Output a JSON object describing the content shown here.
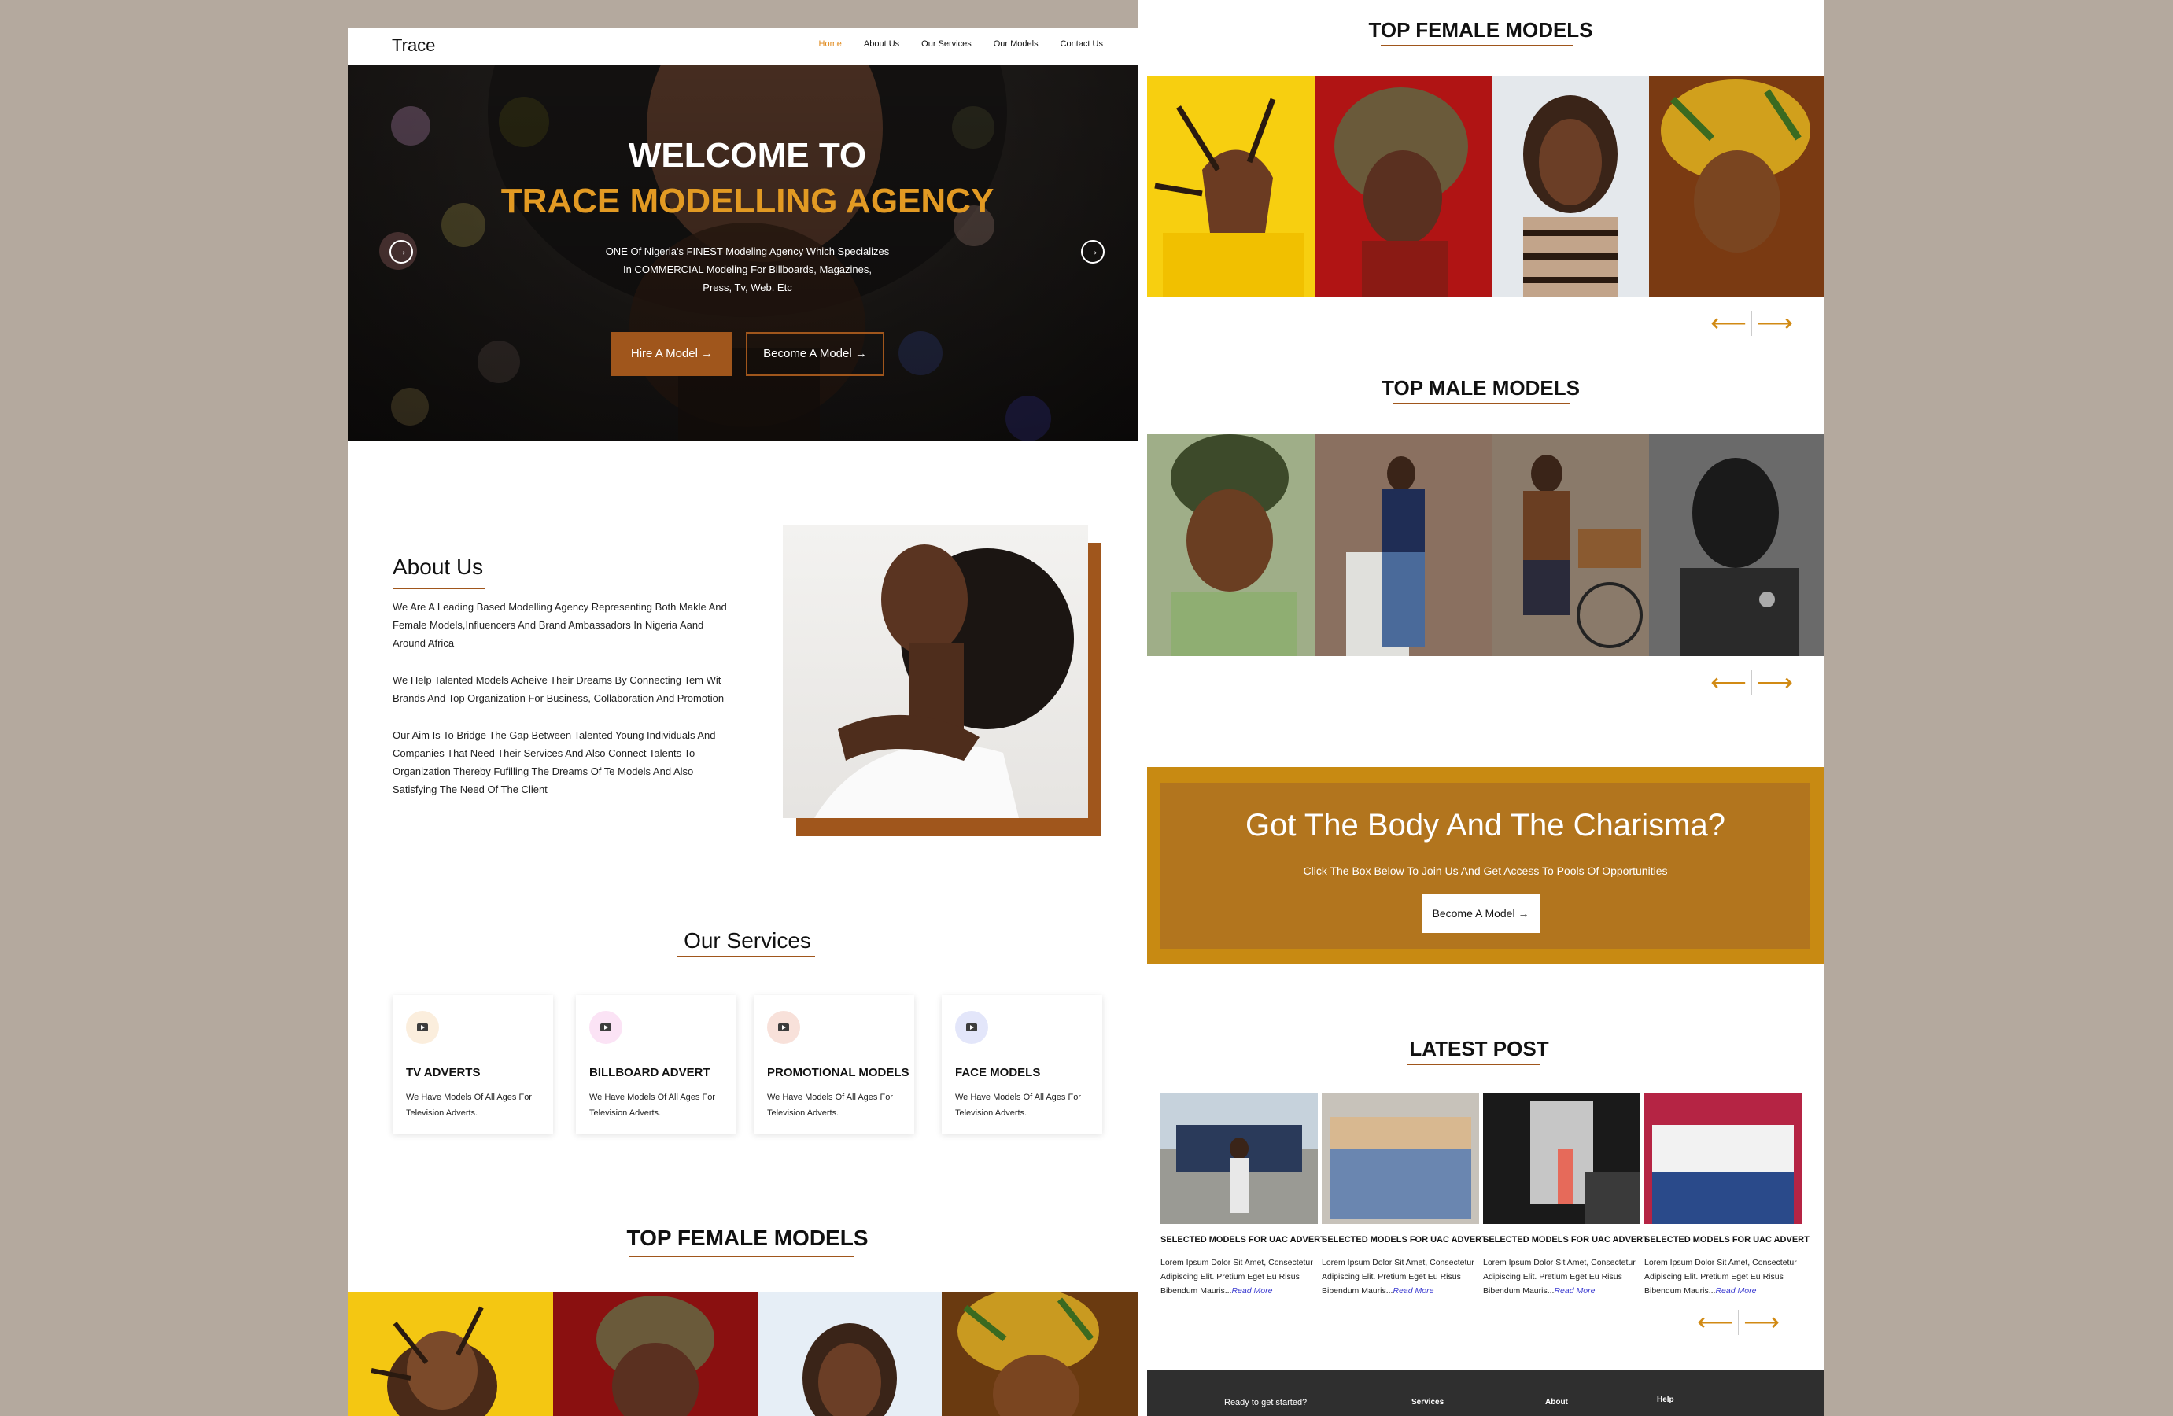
{
  "brand": "Trace",
  "nav": [
    {
      "label": "Home",
      "active": true
    },
    {
      "label": "About Us",
      "active": false
    },
    {
      "label": "Our Services",
      "active": false
    },
    {
      "label": "Our Models",
      "active": false
    },
    {
      "label": "Contact Us",
      "active": false
    }
  ],
  "hero": {
    "title_line1": "WELCOME TO",
    "title_line2": "TRACE MODELLING AGENCY",
    "subtitle_line1": "ONE Of Nigeria's FINEST Modeling Agency Which Specializes",
    "subtitle_line2": "In COMMERCIAL Modeling For Billboards, Magazines,",
    "subtitle_line3": "Press, Tv, Web. Etc",
    "btn_hire": "Hire A Model →",
    "btn_become": "Become A Model →",
    "prev_icon": "arrow-circle-left-icon",
    "next_icon": "arrow-circle-right-icon"
  },
  "about": {
    "title": "About Us",
    "p1": "We Are A Leading Based Modelling Agency Representing Both Makle And Female Models,Influencers And Brand Ambassadors In Nigeria Aand Around Africa",
    "p2": "We Help Talented Models Acheive Their Dreams By Connecting Tem Wit Brands And Top Organization For Business, Collaboration And Promotion",
    "p3": "Our Aim Is To Bridge The Gap Between Talented Young Individuals And Companies That Need Their Services And Also Connect Talents To Organization Thereby Fufilling The Dreams Of Te Models And Also Satisfying The Need Of The Client"
  },
  "services": {
    "title": "Our Services",
    "items": [
      {
        "title": "TV ADVERTS",
        "desc": "We Have Models Of All Ages For Television Adverts.",
        "icon": "youtube-icon",
        "icon_bg": "#fbeedd"
      },
      {
        "title": "BILLBOARD ADVERT",
        "desc": "We Have Models Of All Ages For Television Adverts.",
        "icon": "youtube-icon",
        "icon_bg": "#fbe3f5"
      },
      {
        "title": "PROMOTIONAL MODELS",
        "desc": "We Have Models Of All Ages For Television Adverts.",
        "icon": "youtube-icon",
        "icon_bg": "#f8e1da"
      },
      {
        "title": "FACE MODELS",
        "desc": "We Have Models Of All Ages For Television Adverts.",
        "icon": "youtube-icon",
        "icon_bg": "#e3e6fa"
      }
    ]
  },
  "top_female_title": "TOP FEMALE MODELS",
  "top_male_title": "TOP MALE MODELS",
  "carousel_icons": {
    "prev": "long-arrow-left-icon",
    "next": "long-arrow-right-icon"
  },
  "cta": {
    "title": "Got The Body And The Charisma?",
    "subtitle": "Click The Box Below  To Join Us And Get Access To Pools Of Opportunities",
    "button": "Become A Model →"
  },
  "latest_post": {
    "title": "LATEST POST",
    "posts": [
      {
        "title": "SELECTED MODELS FOR UAC ADVERT",
        "body": "Lorem Ipsum Dolor Sit Amet, Consectetur Adipiscing Elit. Pretium Eget Eu Risus Bibendum Mauris...",
        "read_more": "Read More"
      },
      {
        "title": "SELECTED MODELS FOR UAC ADVERT",
        "body": "Lorem Ipsum Dolor Sit Amet, Consectetur Adipiscing Elit. Pretium Eget Eu Risus Bibendum Mauris...",
        "read_more": "Read More"
      },
      {
        "title": "SELECTED MODELS FOR UAC ADVERT",
        "body": "Lorem Ipsum Dolor Sit Amet, Consectetur Adipiscing Elit. Pretium Eget Eu Risus Bibendum Mauris...",
        "read_more": "Read More"
      },
      {
        "title": "SELECTED MODELS FOR UAC ADVERT",
        "body": "Lorem Ipsum Dolor Sit Amet, Consectetur Adipiscing Elit. Pretium Eget Eu Risus Bibendum Mauris...",
        "read_more": "Read More"
      }
    ]
  },
  "footer": {
    "cta": "Ready to get started?",
    "col1": "Services",
    "col2": "About",
    "col3": "Help"
  },
  "colors": {
    "accent_brown": "#a0561c",
    "accent_gold": "#e29a23",
    "cta_gold": "#c88a12",
    "arrow_gold": "#d18a14",
    "nav_active": "#e0891b"
  }
}
